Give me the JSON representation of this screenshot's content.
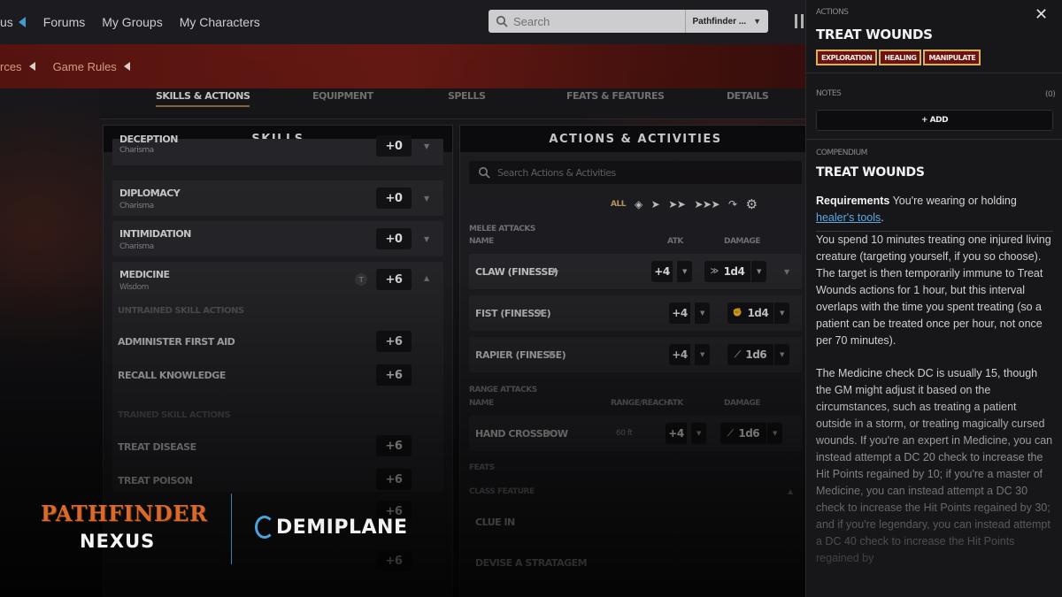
{
  "topnav": {
    "first_item": "us",
    "items": [
      "Forums",
      "My Groups",
      "My Characters"
    ],
    "search_placeholder": "Search",
    "search_scope": "Pathfinder ..."
  },
  "subnav": {
    "items": [
      "rces",
      "Game Rules"
    ]
  },
  "tabs": [
    "SKILLS & ACTIONS",
    "EQUIPMENT",
    "SPELLS",
    "FEATS & FEATURES",
    "DETAILS"
  ],
  "skills_panel": {
    "title": "SKILLS",
    "rows": [
      {
        "name": "DECEPTION",
        "ability": "Charisma",
        "mod": "+0"
      },
      {
        "name": "DIPLOMACY",
        "ability": "Charisma",
        "mod": "+0"
      },
      {
        "name": "INTIMIDATION",
        "ability": "Charisma",
        "mod": "+0"
      },
      {
        "name": "MEDICINE",
        "ability": "Wisdom",
        "mod": "+6",
        "badge": "T"
      }
    ],
    "untrained_label": "UNTRAINED SKILL ACTIONS",
    "untrained": [
      {
        "name": "ADMINISTER FIRST AID",
        "mod": "+6"
      },
      {
        "name": "RECALL KNOWLEDGE",
        "mod": "+6"
      }
    ],
    "trained_label": "TRAINED SKILL ACTIONS",
    "trained": [
      {
        "name": "TREAT DISEASE",
        "mod": "+6"
      },
      {
        "name": "TREAT POISON",
        "mod": "+6"
      },
      {
        "name": "",
        "mod": "+6"
      }
    ],
    "last_mod": "+6"
  },
  "actions_panel": {
    "title": "ACTIONS & ACTIVITIES",
    "search_placeholder": "Search Actions & Activities",
    "filter_all": "ALL",
    "melee_label": "MELEE ATTACKS",
    "col_name": "NAME",
    "col_atk": "ATK",
    "col_damage": "DAMAGE",
    "col_range": "RANGE/REACH",
    "melee": [
      {
        "name": "CLAW (FINESSE)",
        "atk": "+4",
        "damage": "1d4"
      },
      {
        "name": "FIST (FINESSE)",
        "atk": "+4",
        "damage": "1d4"
      },
      {
        "name": "RAPIER (FINESSE)",
        "atk": "+4",
        "damage": "1d6"
      }
    ],
    "range_label": "RANGE ATTACKS",
    "ranged": [
      {
        "name": "HAND CROSSBOW",
        "range": "60 ft",
        "atk": "+4",
        "damage": "1d6"
      }
    ],
    "feats_label": "FEATS",
    "class_feature_label": "CLASS FEATURE",
    "class_feature": "CLUE IN",
    "last_item": "DEVISE A STRATAGEM"
  },
  "side_panel": {
    "kicker": "ACTIONS",
    "title": "TREAT WOUNDS",
    "traits": [
      "EXPLORATION",
      "HEALING",
      "MANIPULATE"
    ],
    "notes_label": "NOTES",
    "notes_count": "(0)",
    "add_label": "+ ADD",
    "compendium_label": "COMPENDIUM",
    "compendium_title": "TREAT WOUNDS",
    "req_label": "Requirements",
    "req_text": " You're wearing or holding ",
    "req_link": "healer's tools",
    "req_end": ".",
    "para1": "You spend 10 minutes treating one injured living creature (targeting yourself, if you so choose). The target is then temporarily immune to Treat Wounds actions for 1 hour, but this interval overlaps with the time you spent treating (so a patient can be treated once per hour, not once per 70 minutes).",
    "para2": "The Medicine check DC is usually 15, though the GM might adjust it based on the circumstances, such as treating a patient outside in a storm, or treating magically cursed wounds. If you're an expert in Medicine, you can instead attempt a DC 20 check to increase the Hit Points regained by 10; if you're a master of Medicine, you can instead attempt a DC 30 check to increase the Hit Points regained by 30; and if you're legendary, you can instead attempt a DC 40 check to increase the Hit Points regained by"
  },
  "logos": {
    "pathfinder": "PATHFINDER",
    "nexus": "NEXUS",
    "demiplane": "DEMIPLANE"
  }
}
